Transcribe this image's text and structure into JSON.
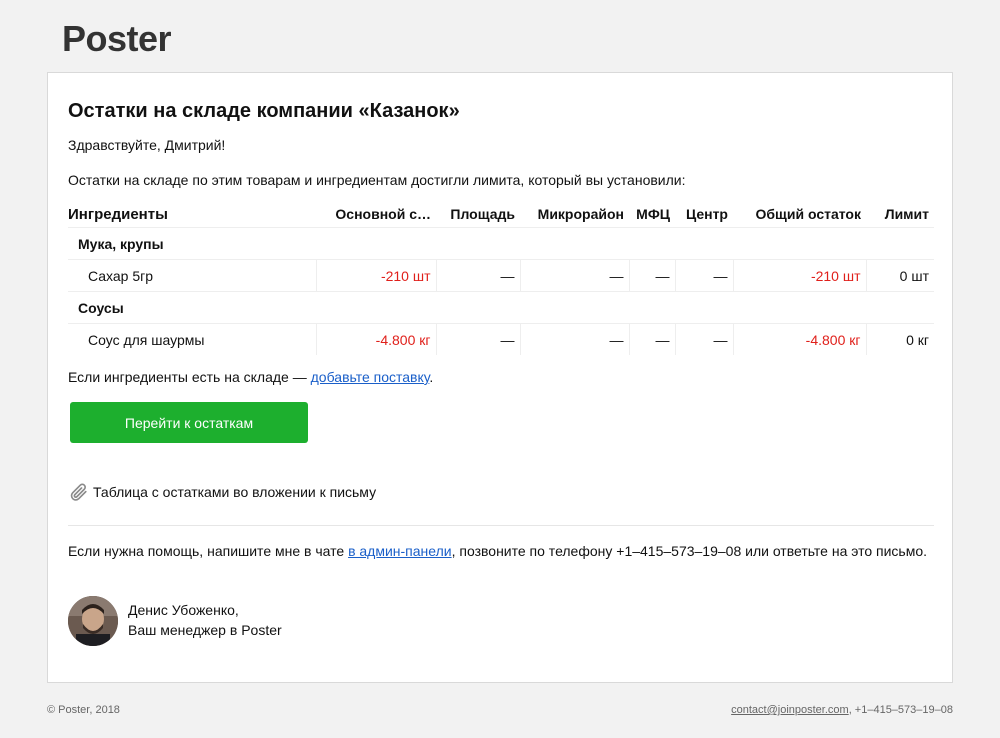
{
  "brand": "Poster",
  "email": {
    "title": "Остатки на складе компании «Казанок»",
    "greeting": "Здравствуйте, Дмитрий!",
    "intro": "Остатки на складе по этим товарам и ингредиентам достигли лимита, который вы установили:",
    "table": {
      "headers": [
        "Ингредиенты",
        "Основной с…",
        "Площадь",
        "Микрорайон",
        "МФЦ",
        "Центр",
        "Общий остаток",
        "Лимит"
      ],
      "groups": [
        {
          "category": "Мука, крупы",
          "rows": [
            {
              "name": "Сахар 5гр",
              "cells": [
                "-210 шт",
                "—",
                "—",
                "—",
                "—",
                "-210 шт",
                "0 шт"
              ]
            }
          ]
        },
        {
          "category": "Соусы",
          "rows": [
            {
              "name": "Соус для шаурмы",
              "cells": [
                "-4.800 кг",
                "—",
                "—",
                "—",
                "—",
                "-4.800 кг",
                "0 кг"
              ]
            }
          ]
        }
      ]
    },
    "supply_text": "Если ингредиенты есть на складе — ",
    "supply_link": "добавьте поставку",
    "supply_end": ".",
    "button_label": "Перейти к остаткам",
    "attachment_text": "Таблица с остатками во вложении к письму",
    "attachment_icon": "paperclip-icon",
    "help_text_1": "Если нужна помощь, напишите мне в чате ",
    "help_link": "в админ-панели",
    "help_text_2": ", позвоните по телефону +1–415–573–19–08 или ответьте на это письмо.",
    "signature": {
      "name": "Денис Убоженко,",
      "role": "Ваш менеджер в Poster"
    }
  },
  "footer": {
    "copyright": "© Poster, 2018",
    "contact_email": "contact@joinposter.com",
    "contact_phone": ", +1–415–573–19–08"
  },
  "colors": {
    "negative": "#e0201b",
    "button": "#1daf2e",
    "link": "#1a5fc9"
  }
}
